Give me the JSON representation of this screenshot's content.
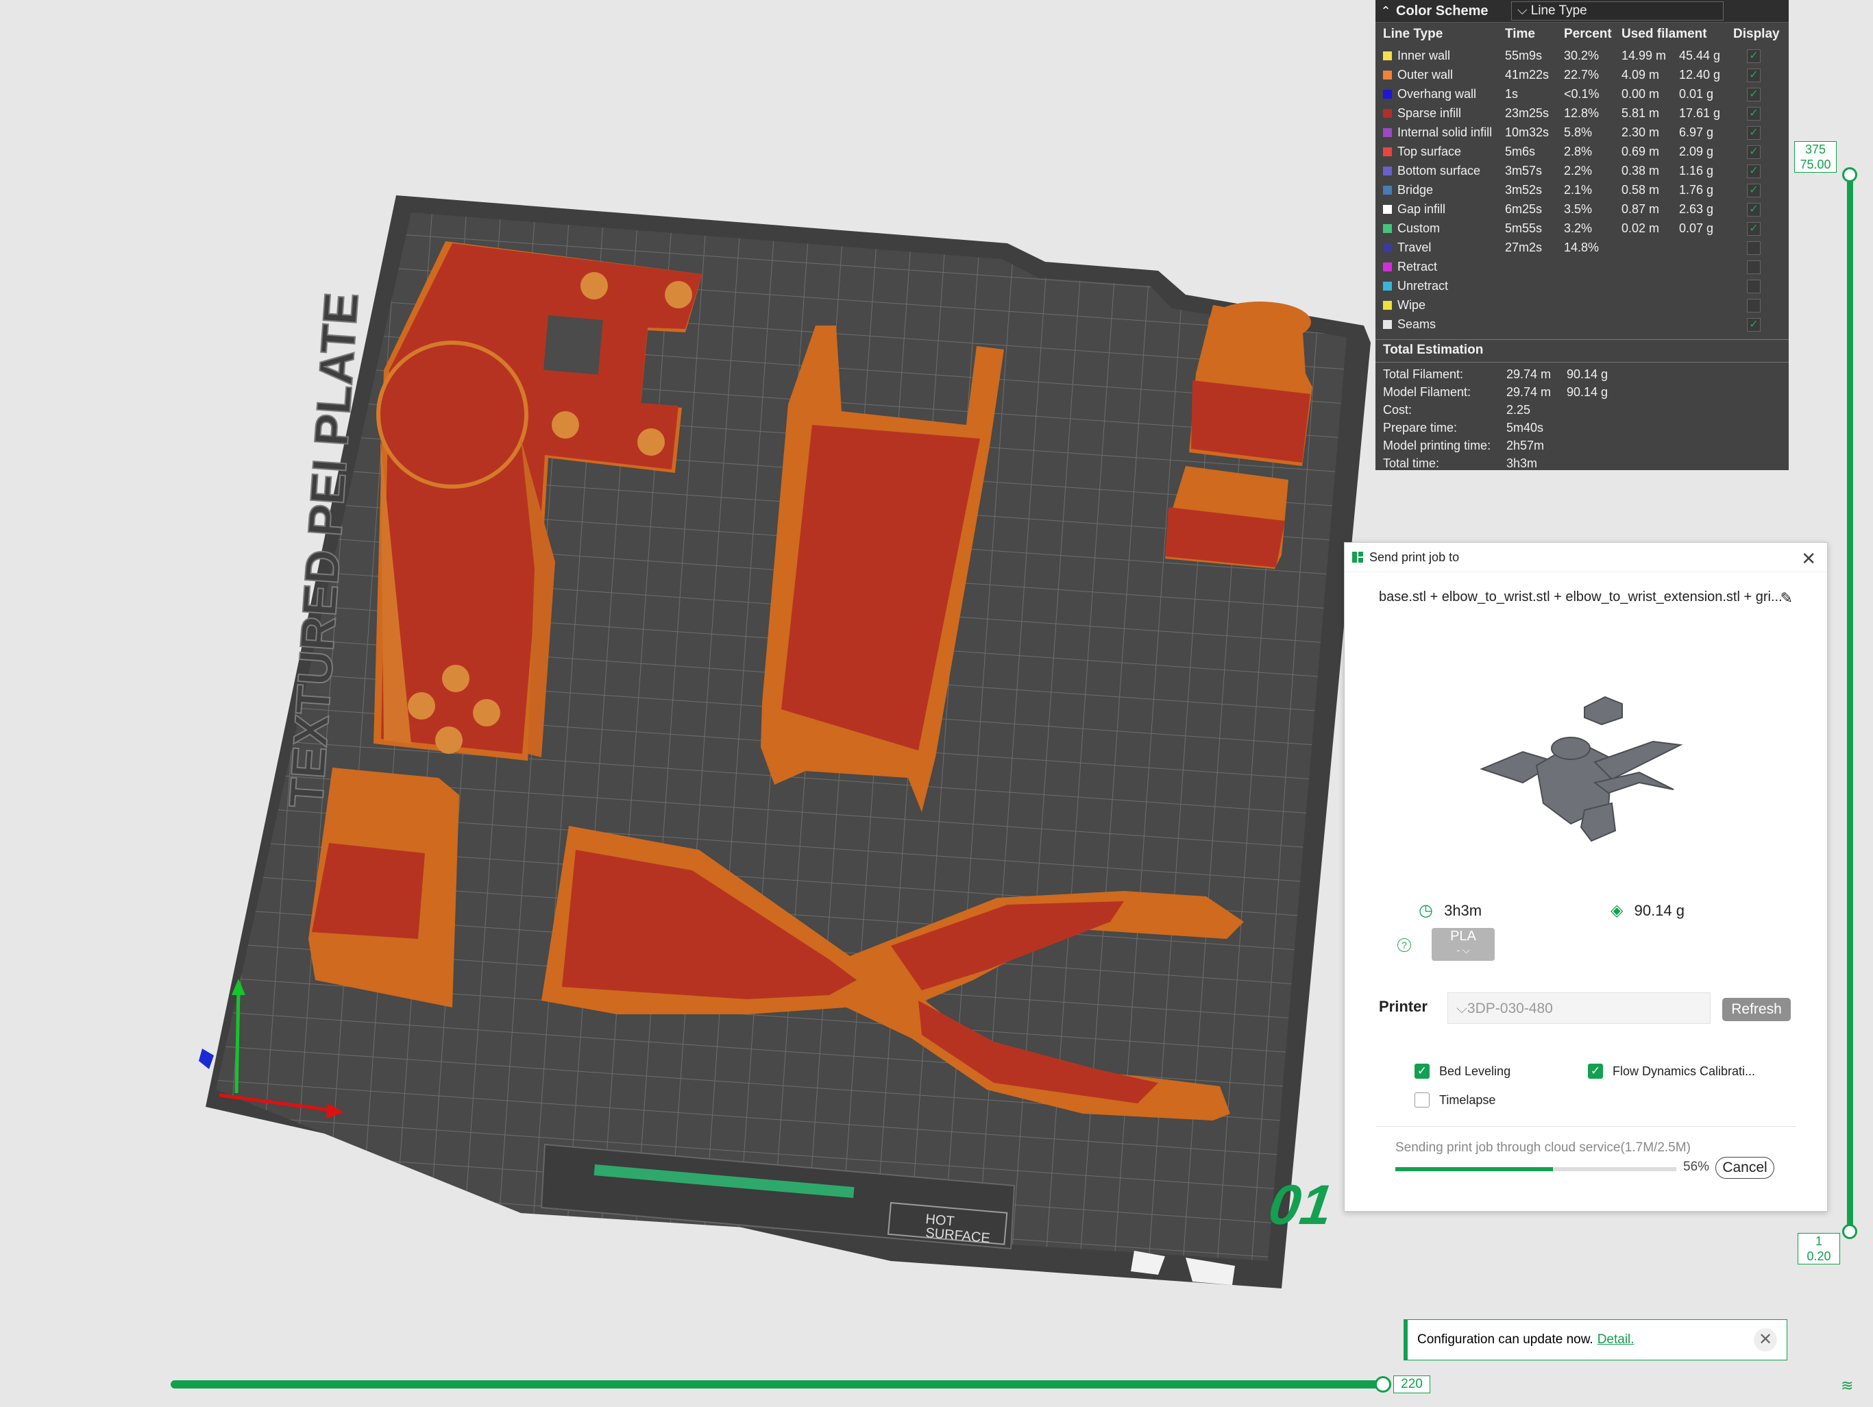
{
  "legend": {
    "collapse_icon": "chevron-up-icon",
    "title": "Color Scheme",
    "scheme_select": "Line Type",
    "columns": [
      "Line Type",
      "Time",
      "Percent",
      "Used filament",
      "Display"
    ],
    "rows": [
      {
        "name": "Inner wall",
        "color": "#f4e04a",
        "time": "55m9s",
        "percent": "30.2%",
        "length": "14.99 m",
        "weight": "45.44 g",
        "checked": true
      },
      {
        "name": "Outer wall",
        "color": "#f0823a",
        "time": "41m22s",
        "percent": "22.7%",
        "length": "4.09 m",
        "weight": "12.40 g",
        "checked": true
      },
      {
        "name": "Overhang wall",
        "color": "#1d17d8",
        "time": "1s",
        "percent": "<0.1%",
        "length": "0.00 m",
        "weight": "0.01 g",
        "checked": true
      },
      {
        "name": "Sparse infill",
        "color": "#b42c2c",
        "time": "23m25s",
        "percent": "12.8%",
        "length": "5.81 m",
        "weight": "17.61 g",
        "checked": true
      },
      {
        "name": "Internal solid infill",
        "color": "#9b49c4",
        "time": "10m32s",
        "percent": "5.8%",
        "length": "2.30 m",
        "weight": "6.97 g",
        "checked": true
      },
      {
        "name": "Top surface",
        "color": "#e8463c",
        "time": "5m6s",
        "percent": "2.8%",
        "length": "0.69 m",
        "weight": "2.09 g",
        "checked": true
      },
      {
        "name": "Bottom surface",
        "color": "#6a60c8",
        "time": "3m57s",
        "percent": "2.2%",
        "length": "0.38 m",
        "weight": "1.16 g",
        "checked": true
      },
      {
        "name": "Bridge",
        "color": "#4a7ab4",
        "time": "3m52s",
        "percent": "2.1%",
        "length": "0.58 m",
        "weight": "1.76 g",
        "checked": true
      },
      {
        "name": "Gap infill",
        "color": "#ffffff",
        "time": "6m25s",
        "percent": "3.5%",
        "length": "0.87 m",
        "weight": "2.63 g",
        "checked": true
      },
      {
        "name": "Custom",
        "color": "#45c47c",
        "time": "5m55s",
        "percent": "3.2%",
        "length": "0.02 m",
        "weight": "0.07 g",
        "checked": true
      },
      {
        "name": "Travel",
        "color": "#3a3aa0",
        "time": "27m2s",
        "percent": "14.8%",
        "length": "",
        "weight": "",
        "checked": false
      },
      {
        "name": "Retract",
        "color": "#d02fd8",
        "time": "",
        "percent": "",
        "length": "",
        "weight": "",
        "checked": false
      },
      {
        "name": "Unretract",
        "color": "#3cb4d8",
        "time": "",
        "percent": "",
        "length": "",
        "weight": "",
        "checked": false
      },
      {
        "name": "Wipe",
        "color": "#f0e038",
        "time": "",
        "percent": "",
        "length": "",
        "weight": "",
        "checked": false
      },
      {
        "name": "Seams",
        "color": "#e6e6e6",
        "time": "",
        "percent": "",
        "length": "",
        "weight": "",
        "checked": true
      }
    ],
    "totals_title": "Total Estimation",
    "totals": [
      {
        "label": "Total Filament:",
        "v1": "29.74 m",
        "v2": "90.14 g"
      },
      {
        "label": "Model Filament:",
        "v1": "29.74 m",
        "v2": "90.14 g"
      },
      {
        "label": "Cost:",
        "v1": "2.25",
        "v2": ""
      },
      {
        "label": "Prepare time:",
        "v1": "5m40s",
        "v2": ""
      },
      {
        "label": "Model printing time:",
        "v1": "2h57m",
        "v2": ""
      },
      {
        "label": "Total time:",
        "v1": "3h3m",
        "v2": ""
      }
    ]
  },
  "dialog": {
    "title": "Send print job to",
    "filename": "base.stl + elbow_to_wrist.stl + elbow_to_wrist_extension.stl + gri...",
    "time": "3h3m",
    "weight": "90.14 g",
    "material": "PLA",
    "material_sub": "-",
    "printer_label": "Printer",
    "printer_value": "3DP-030-480",
    "refresh_label": "Refresh",
    "options": [
      {
        "label": "Bed Leveling",
        "checked": true
      },
      {
        "label": "Flow Dynamics Calibrati...",
        "checked": true
      },
      {
        "label": "Timelapse",
        "checked": false
      }
    ],
    "status": "Sending print job through cloud service(1.7M/2.5M)",
    "progress": 0.56,
    "progress_text": "56%",
    "cancel_label": "Cancel"
  },
  "layer_slider": {
    "top_layer": "375",
    "top_height": "75.00",
    "bottom_layer": "1",
    "bottom_height": "0.20"
  },
  "move_slider": {
    "value": "220"
  },
  "plate": {
    "number": "01",
    "hot_label_1": "HOT",
    "hot_label_2": "SURFACE"
  },
  "toast": {
    "message": "Configuration can update now.",
    "link": "Detail."
  }
}
